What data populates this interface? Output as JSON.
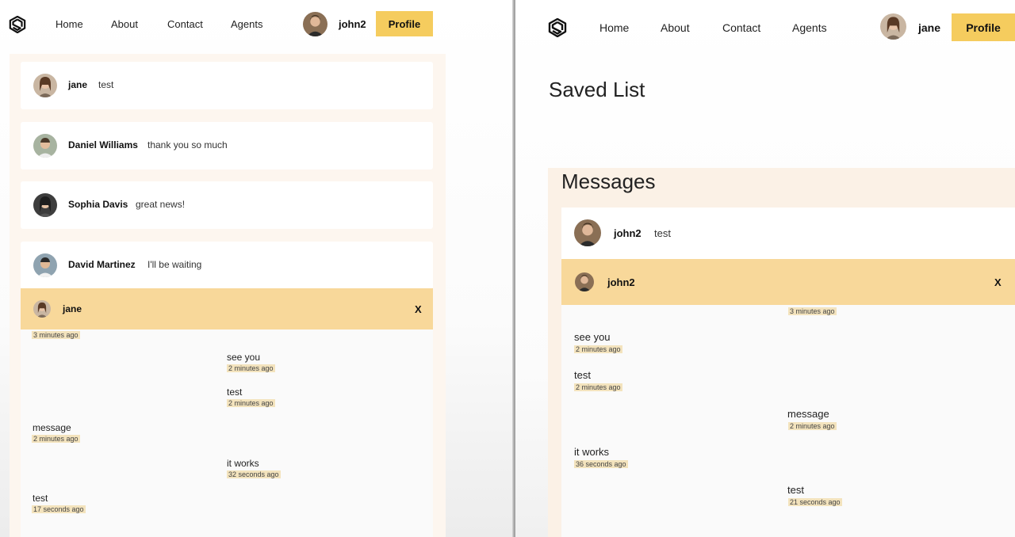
{
  "left": {
    "nav": {
      "links": [
        "Home",
        "About",
        "Contact",
        "Agents"
      ],
      "username": "john2",
      "profile_label": "Profile"
    },
    "chats": [
      {
        "name": "jane",
        "message": "test"
      },
      {
        "name": "Daniel Williams",
        "message": "thank you so much"
      },
      {
        "name": "Sophia Davis",
        "message": "great news!"
      },
      {
        "name": "David Martinez",
        "message": "I'll be waiting"
      }
    ],
    "chat_box": {
      "name": "jane",
      "close": "X",
      "messages": [
        {
          "text": "",
          "time": "3 minutes ago",
          "own": false
        },
        {
          "text": "see you",
          "time": "2 minutes ago",
          "own": true
        },
        {
          "text": "test",
          "time": "2 minutes ago",
          "own": true
        },
        {
          "text": "message",
          "time": "2 minutes ago",
          "own": false
        },
        {
          "text": "it works",
          "time": "32 seconds ago",
          "own": true
        },
        {
          "text": "test",
          "time": "17 seconds ago",
          "own": false
        }
      ]
    }
  },
  "right": {
    "nav": {
      "links": [
        "Home",
        "About",
        "Contact",
        "Agents"
      ],
      "username": "jane",
      "profile_label": "Profile"
    },
    "saved_title": "Saved List",
    "messages_title": "Messages",
    "chats": [
      {
        "name": "john2",
        "message": "test"
      }
    ],
    "chat_box": {
      "name": "john2",
      "close": "X",
      "messages": [
        {
          "text": "",
          "time": "3 minutes ago",
          "own": true
        },
        {
          "text": "see you",
          "time": "2 minutes ago",
          "own": false
        },
        {
          "text": "test",
          "time": "2 minutes ago",
          "own": false
        },
        {
          "text": "message",
          "time": "2 minutes ago",
          "own": true
        },
        {
          "text": "it works",
          "time": "36 seconds ago",
          "own": false
        },
        {
          "text": "test",
          "time": "21 seconds ago",
          "own": true
        }
      ]
    }
  },
  "colors": {
    "accent": "#f5cc5e",
    "chat_header": "#f8d89a",
    "section_bg": "#fbf1e6",
    "timestamp_bg": "#f3e3bd"
  },
  "icons": {
    "logo": "logo-icon",
    "avatar": "user-avatar"
  }
}
